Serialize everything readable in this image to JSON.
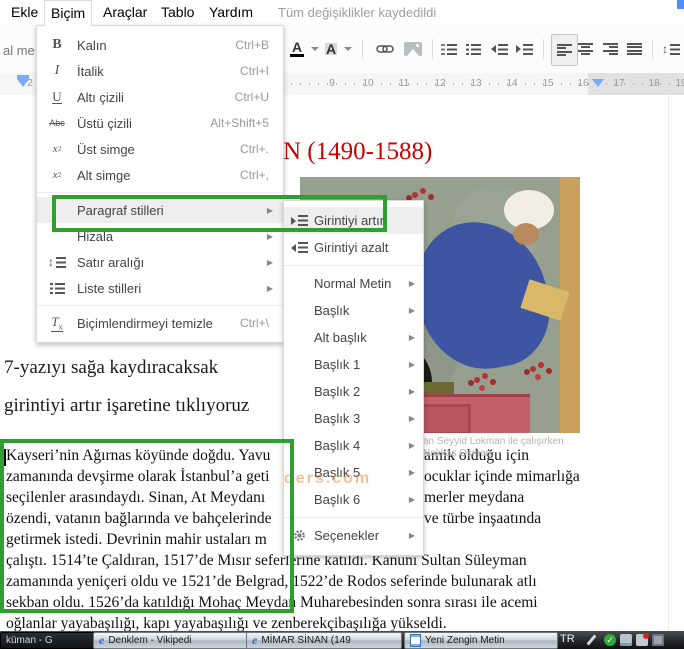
{
  "menubar": {
    "ekle": "Ekle",
    "bicim": "Biçim",
    "araclar": "Araçlar",
    "tablo": "Tablo",
    "yardim": "Yardım",
    "status": "Tüm değişiklikler kaydedildi"
  },
  "toolbar": {
    "style_fragment": "al me...",
    "text_color_glyph": "A",
    "highlight_glyph": "A"
  },
  "ruler": {
    "left_number": "2",
    "numbers": [
      "9",
      "10",
      "11",
      "12",
      "13",
      "14",
      "15",
      "16",
      "17",
      "18",
      "19"
    ]
  },
  "format_menu": {
    "items": [
      {
        "label": "Kalın",
        "shortcut": "Ctrl+B"
      },
      {
        "label": "İtalik",
        "shortcut": "Ctrl+I"
      },
      {
        "label": "Altı çizili",
        "shortcut": "Ctrl+U"
      },
      {
        "label": "Üstü çizili",
        "shortcut": "Alt+Shift+5"
      },
      {
        "label": "Üst simge",
        "shortcut": "Ctrl+."
      },
      {
        "label": "Alt simge",
        "shortcut": "Ctrl+,"
      },
      {
        "label": "Paragraf stilleri",
        "shortcut": ""
      },
      {
        "label": "Hizala",
        "shortcut": ""
      },
      {
        "label": "Satır aralığı",
        "shortcut": ""
      },
      {
        "label": "Liste stilleri",
        "shortcut": ""
      },
      {
        "label": "Biçimlendirmeyi temizle",
        "shortcut": "Ctrl+\\"
      }
    ]
  },
  "styles_menu": {
    "items": [
      {
        "label": "Girintiyi artır"
      },
      {
        "label": "Girintiyi azalt"
      },
      {
        "label": "Normal Metin"
      },
      {
        "label": "Başlık"
      },
      {
        "label": "Alt başlık"
      },
      {
        "label": "Başlık 1"
      },
      {
        "label": "Başlık 2"
      },
      {
        "label": "Başlık 3"
      },
      {
        "label": "Başlık 4"
      },
      {
        "label": "Başlık 5"
      },
      {
        "label": "Başlık 6"
      },
      {
        "label": "Seçenekler"
      }
    ]
  },
  "document": {
    "title": "N (1490-1588)",
    "instruction_line1": "7-yazıyı sağa kaydıracaksak",
    "instruction_line2": "girintiyi artır işaretine tıklıyoruz",
    "image_caption_line1": "an Seyyid Lokman ile çalışırken",
    "image_caption_line2": "Nakkaş Osman.",
    "watermark": "ders.com",
    "paragraph_lines": [
      {
        "left": "Kayseri’nin Ağırnas köyünde doğdu. Yavu",
        "right": "amik olduğu için"
      },
      {
        "left": "zamanında devşirme olarak İstanbul’a geti",
        "right": "ocuklar içinde mimarlığa"
      },
      {
        "left": "seçilenler arasındaydı. Sinan, At Meydanı",
        "right": "merler meydana"
      },
      {
        "left": "özendi, vatanın bağlarında ve bahçelerinde",
        "right": "ve türbe inşaatında"
      },
      {
        "left": "getirmek istedi. Devrinin mahir ustaları m",
        "right": ""
      },
      {
        "full": "çalıştı. 1514’te Çaldıran, 1517’de Mısır seferlerine katıldı. Kanunî Sultan Süleyman"
      },
      {
        "full": "zamanında yeniçeri oldu ve 1521’de Belgrad, 1522’de Rodos seferinde bulunarak atlı"
      },
      {
        "full": "sekban oldu. 1526’da katıldığı Mohaç Meydan Muharebesinden sonra sırası ile acemi"
      },
      {
        "full": "oğlanlar yayabaşılığı, kapı yayabaşılığı ve zenberekçibaşılığa yükseldi."
      }
    ]
  },
  "taskbar": {
    "button1": "küman - G",
    "button2": "Denklem - Vikipedi",
    "button3": "MİMAR SİNAN (149",
    "button4": "Yeni Zengin Metin",
    "language": "TR"
  },
  "colors": {
    "annotation_green": "#2fa02f",
    "title_red": "#cc0000",
    "corner_blue": "#4d90fe"
  }
}
